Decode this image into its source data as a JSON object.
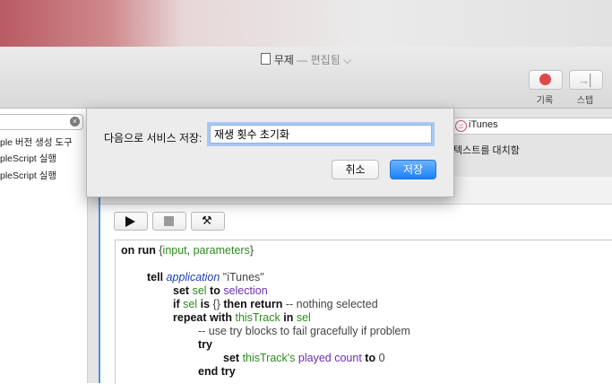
{
  "window": {
    "title": "무제",
    "title_sep": " — ",
    "title_status": "편집됨",
    "title_chevron": "⌵"
  },
  "toolbar": {
    "record_label": "기록",
    "step_label": "스텝",
    "step_icon": "→▏"
  },
  "left_pane": {
    "items": [
      "ple 버전 생성 도구",
      "pleScript 실행",
      "pleScript 실행"
    ]
  },
  "workflow": {
    "itunes_label": "iTunes",
    "replace_text": "텍스트를 대치함"
  },
  "dialog": {
    "label": "다음으로 서비스 저장:",
    "input_value": "재생 횟수 초기화",
    "cancel": "취소",
    "save": "저장"
  },
  "script": {
    "l1": {
      "kw1": "on run",
      "p1": " {",
      "a": "input",
      "c": ", ",
      "b": "parameters",
      "p2": "}"
    },
    "l2": {
      "kw": "tell",
      "app": "application",
      "str": " \"iTunes\""
    },
    "l3": {
      "kw1": "set",
      "v1": "sel",
      "kw2": "to",
      "v2": "selection"
    },
    "l4": {
      "kw1": "if",
      "v1": "sel",
      "kw2": "is",
      "p": "{}",
      "kw3": "then return",
      "cm": "-- nothing selected"
    },
    "l5": {
      "kw1": "repeat with",
      "v1": "thisTrack",
      "kw2": "in",
      "v2": "sel"
    },
    "l6": {
      "cm": "-- use try blocks to fail gracefully if problem"
    },
    "l7": {
      "kw": "try"
    },
    "l8": {
      "kw1": "set",
      "v1": "thisTrack's",
      "v2": "played count",
      "kw2": "to",
      "num": "0"
    },
    "l9": {
      "kw": "end try"
    }
  }
}
